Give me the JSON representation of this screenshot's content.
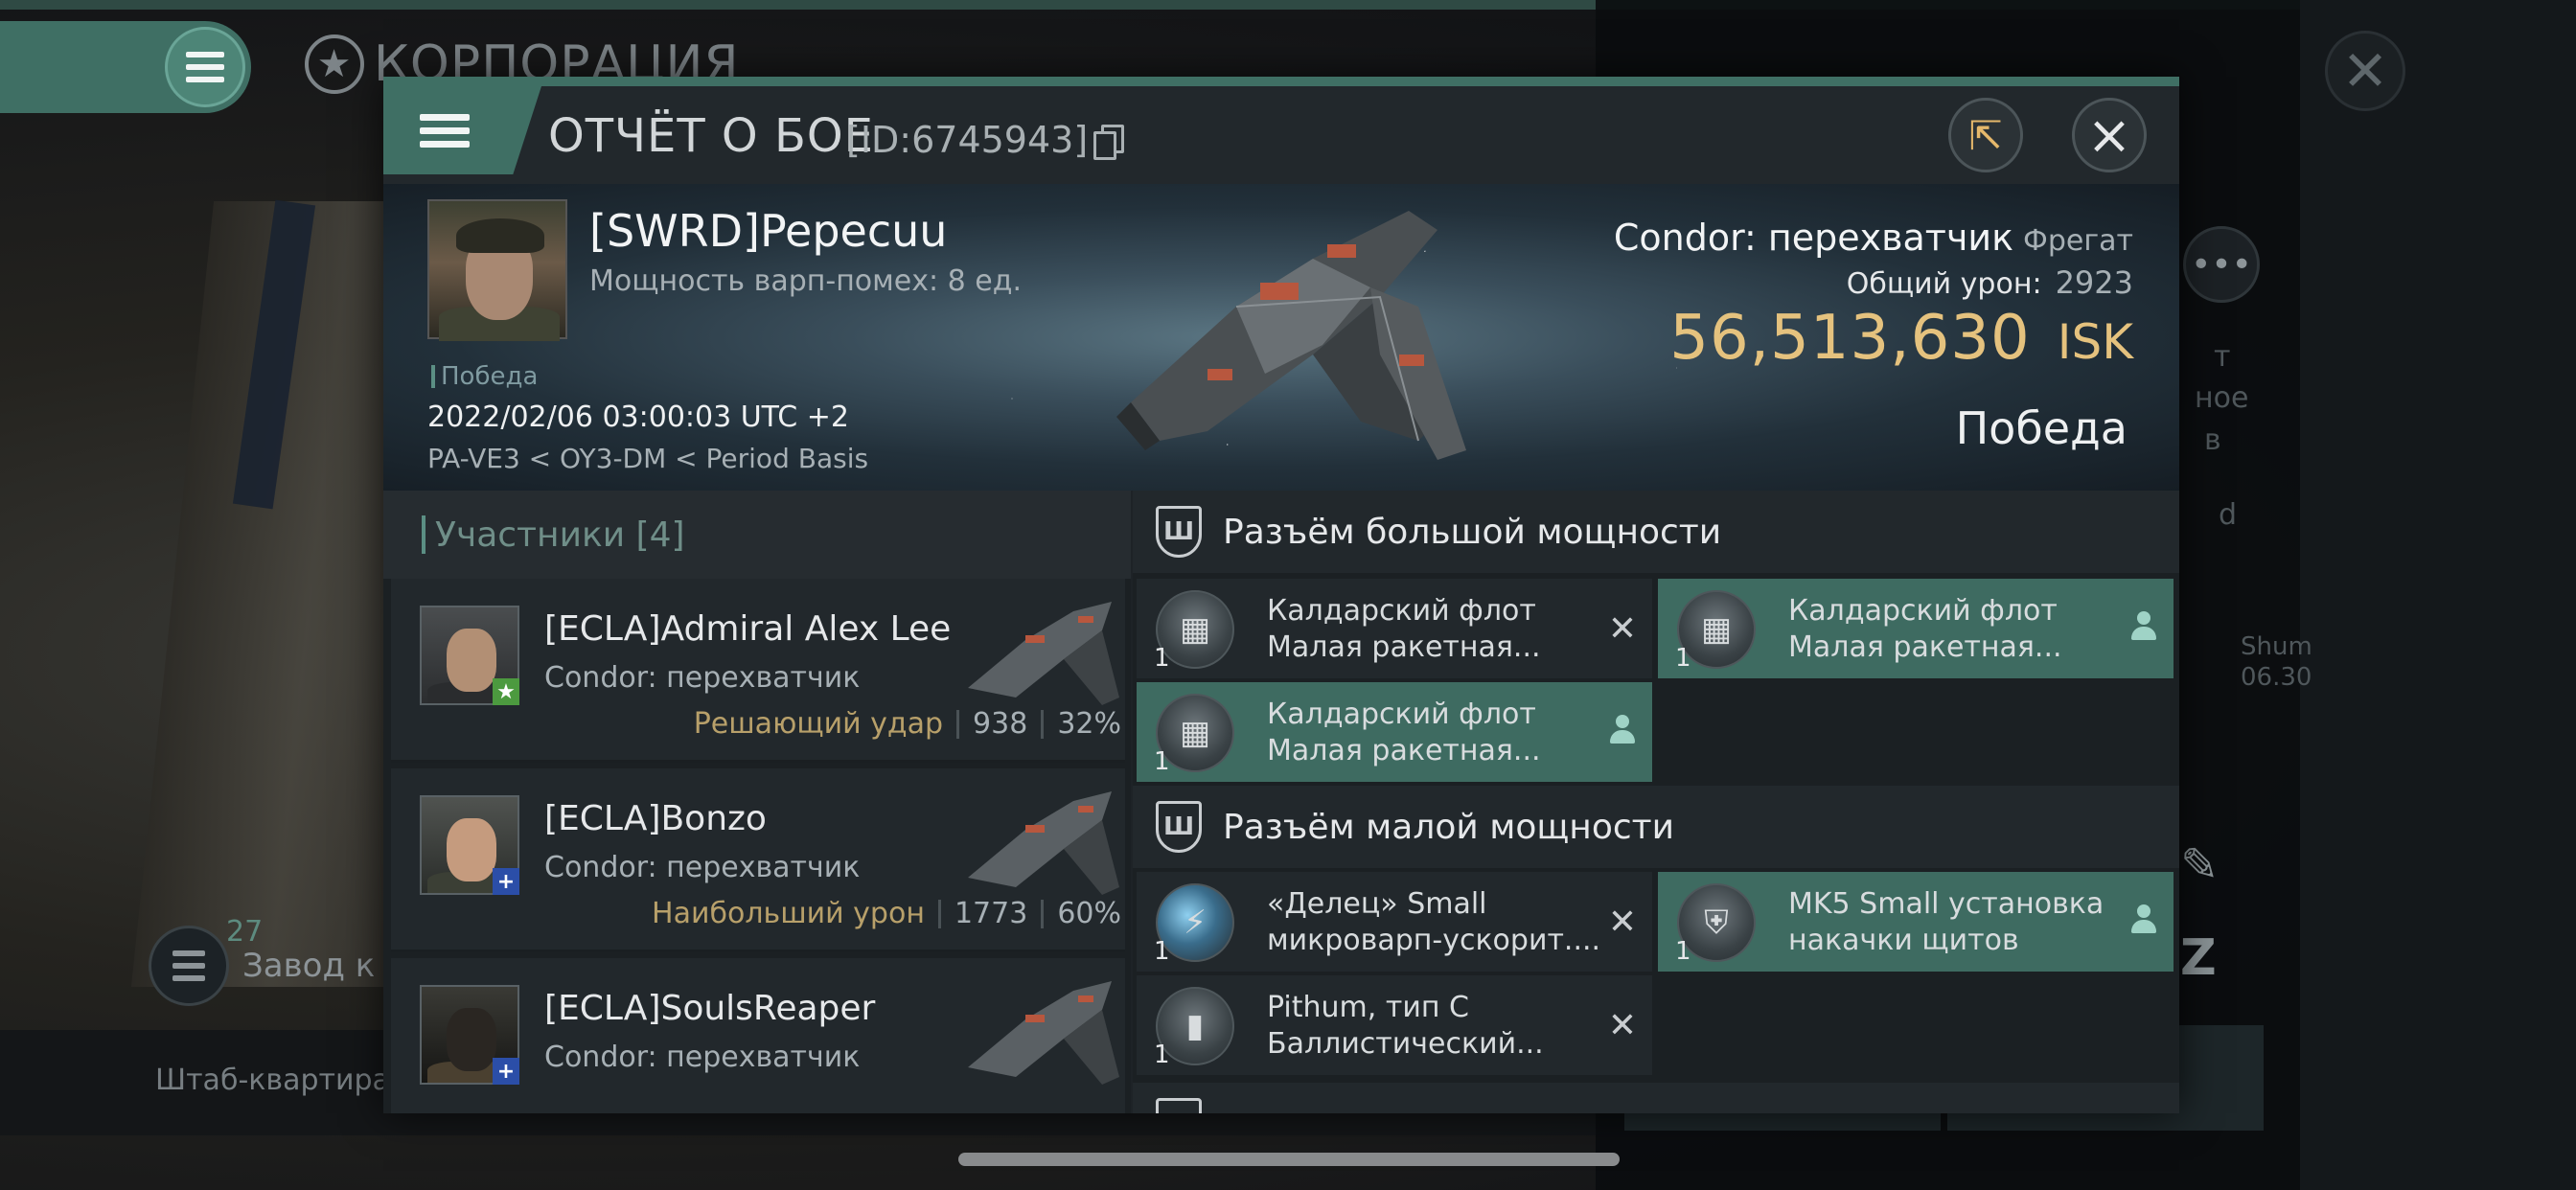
{
  "background": {
    "corp_title": "КОРПОРАЦИЯ",
    "side_text_1": "т",
    "side_text_2": "ное",
    "side_text_3": "в",
    "side_text_4": "d",
    "side_text_5": "Shum",
    "side_text_6": "06.30",
    "factory_count": "27",
    "factory_label": "Завод к",
    "hq_label": "Штаб-квартира К"
  },
  "modal": {
    "title": "ОТЧЁТ О БОЕ",
    "report_id": "[ID:6745943]",
    "victim": {
      "name": "[SWRD]Pepecuu",
      "warp_scramble": "Мощность варп-помех: 8 ед.",
      "status": "Победа",
      "datetime": "2022/02/06 03:00:03 UTC +2",
      "location": "PA-VE3 < OY3-DM < Period Basis",
      "ship_name": "Condor: перехватчик",
      "ship_class": "Фрегат",
      "damage_label": "Общий урон:",
      "damage_value": "2923",
      "isk_value": "56,513,630",
      "isk_unit": "ISK",
      "result": "Победа"
    },
    "participants": {
      "header": "Участники [4]",
      "items": [
        {
          "name": "[ECLA]Admiral Alex Lee",
          "ship": "Condor: перехватчик",
          "role": "Решающий удар",
          "damage": "938",
          "percent": "32%"
        },
        {
          "name": "[ECLA]Bonzo",
          "ship": "Condor: перехватчик",
          "role": "Наибольший урон",
          "damage": "1773",
          "percent": "60%"
        },
        {
          "name": "[ECLA]SoulsReaper",
          "ship": "Condor: перехватчик",
          "role": "",
          "damage": "",
          "percent": ""
        }
      ]
    },
    "fittings": {
      "high_slot_title": "Разъём большой мощности",
      "low_slot_title": "Разъём малой мощности",
      "high": [
        {
          "line1": "Калдарский флот",
          "line2": "Малая ракетная...",
          "qty": "1",
          "state": "destroyed"
        },
        {
          "line1": "Калдарский флот",
          "line2": "Малая ракетная...",
          "qty": "1",
          "state": "dropped"
        },
        {
          "line1": "Калдарский флот",
          "line2": "Малая ракетная...",
          "qty": "1",
          "state": "dropped"
        }
      ],
      "low": [
        {
          "line1": "«Делец» Small",
          "line2": "микроварп-ускорит....",
          "qty": "1",
          "state": "destroyed"
        },
        {
          "line1": "MK5 Small установка",
          "line2": " накачки щитов",
          "qty": "1",
          "state": "dropped"
        },
        {
          "line1": "Pithum, тип C",
          "line2": "Баллистический...",
          "qty": "1",
          "state": "destroyed"
        }
      ]
    }
  },
  "colors": {
    "accent": "#3f6f64",
    "isk": "#e5c27e",
    "role": "#b8a06a"
  }
}
